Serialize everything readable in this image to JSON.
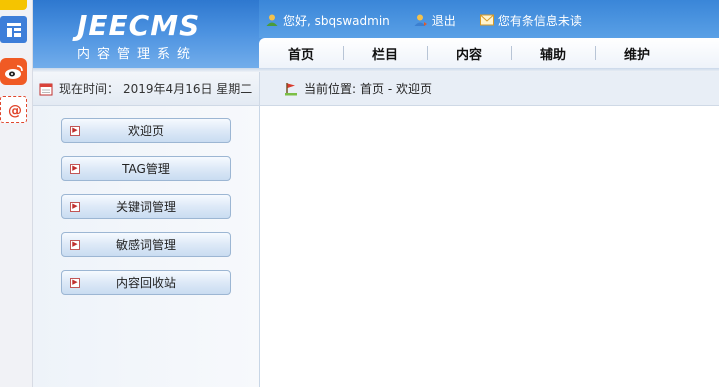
{
  "strip_icons": [
    "folder-icon",
    "layout-icon",
    "weibo-icon",
    "mail-at-icon"
  ],
  "header": {
    "logo_en": "JEECMS",
    "logo_cn": "内容管理系统",
    "greeting": "您好, sbqswadmin",
    "logout": "退出",
    "messages": "您有条信息未读"
  },
  "nav": {
    "tabs": [
      "首页",
      "栏目",
      "内容",
      "辅助",
      "维护"
    ]
  },
  "subbar": {
    "date_label": "现在时间：",
    "date_value": "2019年4月16日 星期二",
    "crumb_label": "当前位置:",
    "crumb_value": "首页 - 欢迎页"
  },
  "sidebar": {
    "items": [
      "欢迎页",
      "TAG管理",
      "关键词管理",
      "敏感词管理",
      "内容回收站"
    ]
  },
  "colors": {
    "header_blue": "#2e78cf",
    "nav_bg": "#ffffff",
    "button_border": "#9cb6d3"
  }
}
